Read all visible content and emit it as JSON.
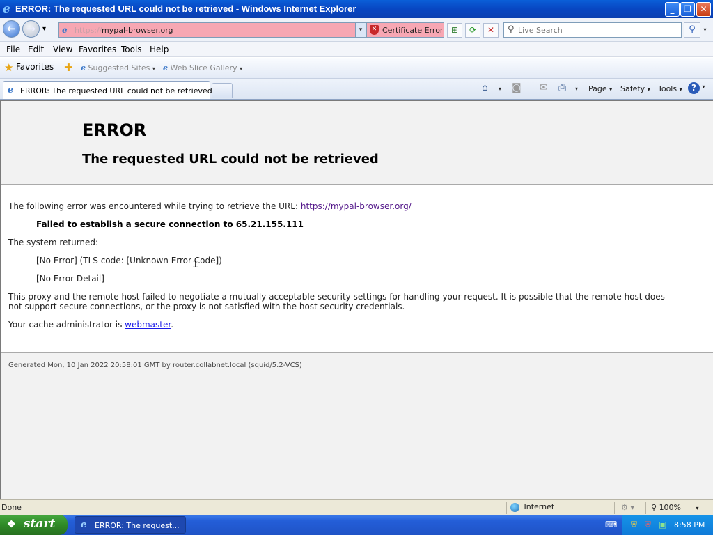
{
  "window": {
    "title": "ERROR: The requested URL could not be retrieved - Windows Internet Explorer",
    "minimize": "_",
    "restore": "❐",
    "close": "✕"
  },
  "nav": {
    "back": "←",
    "forward": "→",
    "history": "▾",
    "address_scheme": "https://",
    "address_host": "mypal-browser.org",
    "cert_error": "Certificate Error",
    "compat": "⊞",
    "refresh": "⟳",
    "stop": "✕",
    "search_placeholder": "Live Search",
    "search_go": "⚲",
    "search_options": "▾"
  },
  "menu": {
    "items": [
      "File",
      "Edit",
      "View",
      "Favorites",
      "Tools",
      "Help"
    ]
  },
  "favorites_bar": {
    "favorites_label": "Favorites",
    "suggested_sites": "Suggested Sites",
    "web_slice_gallery": "Web Slice Gallery"
  },
  "tabs": [
    {
      "label": "ERROR: The requested URL could not be retrieved"
    }
  ],
  "command_bar": {
    "page": "Page",
    "safety": "Safety",
    "tools": "Tools",
    "help": "?"
  },
  "page": {
    "h1": "ERROR",
    "h2": "The requested URL could not be retrieved",
    "intro_text": "The following error was encountered while trying to retrieve the URL: ",
    "url_link": "https://mypal-browser.org/",
    "failed": "Failed to establish a secure connection to 65.21.155.111",
    "system_returned": "The system returned:",
    "tls_error": "[No Error] (TLS code: [Unknown Error Code])",
    "error_detail": "[No Error Detail]",
    "proxy_line1": "This proxy and the remote host failed to negotiate a mutually acceptable security settings for handling your request. It is possible that the remote host does",
    "proxy_line2": "not support secure connections, or the proxy is not satisfied with the host security credentials.",
    "admin_prefix": "Your cache administrator is ",
    "admin_link": "webmaster",
    "admin_suffix": ".",
    "footer": "Generated Mon, 10 Jan 2022 20:58:01 GMT by router.collabnet.local (squid/5.2-VCS)"
  },
  "status_bar": {
    "status": "Done",
    "zone": "Internet",
    "zoom": "100%"
  },
  "taskbar": {
    "start": "start",
    "task_label": "ERROR: The request...",
    "clock": "8:58 PM"
  },
  "icons": {
    "ie": "ie-logo-icon",
    "star": "favorites-star-icon",
    "home": "home-icon",
    "feeds": "feeds-icon",
    "mail": "mail-icon",
    "print": "print-icon",
    "shield": "certificate-shield-icon"
  },
  "colors": {
    "address_error_bg": "#f7a7b3",
    "titlebar": "#0846c2",
    "taskbar": "#245ed8",
    "start_button": "#2f8a27",
    "link_visited": "#551a8b",
    "link": "#1a1ae8"
  }
}
